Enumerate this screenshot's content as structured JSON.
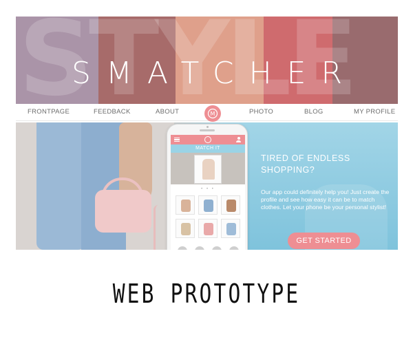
{
  "banner": {
    "background_word": "STYLE",
    "brand": "SMATCHER"
  },
  "nav": {
    "items": [
      "FRONTPAGE",
      "FEEDBACK",
      "ABOUT",
      "PHOTO",
      "BLOG",
      "MY PROFILE"
    ],
    "logo_letter": "M"
  },
  "hero": {
    "headline": "TIRED OF ENDLESS SHOPPING?",
    "copy": "Our app could definitely help you! Just create the profile and see how easy it can be to match clothes. Let your phone be your personal stylist!",
    "cta": "GET STARTED"
  },
  "phone": {
    "screen_title": "MATCH IT",
    "dots": "• • •"
  },
  "caption": "WEB PROTOTYPE",
  "colors": {
    "accent_pink": "#ee8e93",
    "banner_pink": "#e2a3a8",
    "sky_blue": "#8fcbe0",
    "text_gray": "#6c6c6c"
  }
}
